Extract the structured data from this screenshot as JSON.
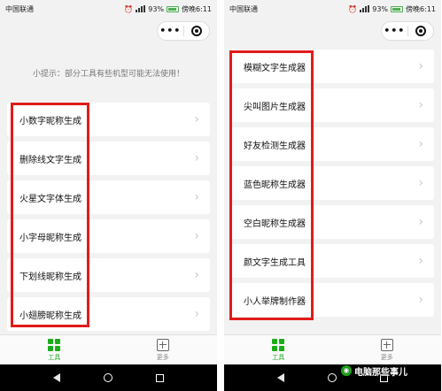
{
  "status_bar": {
    "carrier": "中国联通",
    "battery": "93%",
    "time": "傍晚6:11"
  },
  "capsule": {
    "more_label": "•••"
  },
  "left_screen": {
    "tip": "小提示：部分工具有些机型可能无法使用！",
    "items": [
      {
        "label": "小数字昵称生成"
      },
      {
        "label": "删除线文字生成"
      },
      {
        "label": "火星文字体生成"
      },
      {
        "label": "小字母昵称生成"
      },
      {
        "label": "下划线昵称生成"
      },
      {
        "label": "小翅膀昵称生成"
      }
    ]
  },
  "right_screen": {
    "items": [
      {
        "label": "模糊文字生成器"
      },
      {
        "label": "尖叫图片生成器"
      },
      {
        "label": "好友检测生成器"
      },
      {
        "label": "蓝色昵称生成器"
      },
      {
        "label": "空白昵称生成器"
      },
      {
        "label": "颜文字生成工具"
      },
      {
        "label": "小人举牌制作器"
      }
    ]
  },
  "tabbar": {
    "tools_label": "工具",
    "more_label": "更多"
  },
  "watermark": "电脑那些事儿",
  "colors": {
    "accent": "#1aad19",
    "highlight": "#e11b1b"
  }
}
